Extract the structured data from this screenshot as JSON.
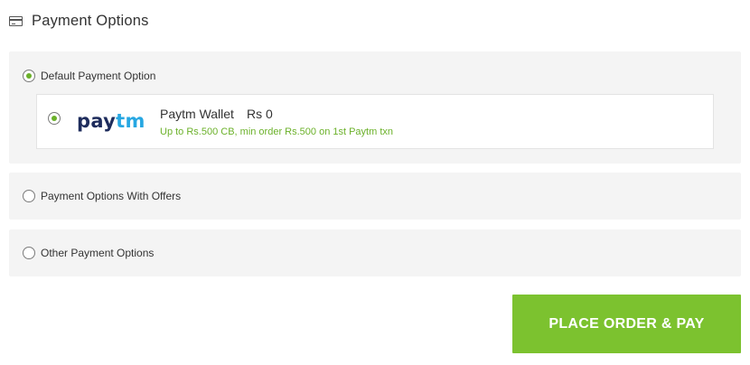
{
  "header": {
    "title": "Payment Options",
    "icon": "credit-card-icon"
  },
  "sections": {
    "default": {
      "label": "Default Payment Option",
      "selected": true
    },
    "offers": {
      "label": "Payment Options With Offers",
      "selected": false
    },
    "other": {
      "label": "Other Payment Options",
      "selected": false
    }
  },
  "wallet": {
    "logo_pay": "pay",
    "logo_tm": "tm",
    "name": "Paytm Wallet",
    "amount": "Rs 0",
    "offer": "Up to Rs.500 CB, min order Rs.500 on 1st Paytm txn",
    "selected": true
  },
  "actions": {
    "place_order_label": "PLACE ORDER & PAY"
  },
  "colors": {
    "accent_green": "#7cc22f",
    "offer_green": "#6bb12a",
    "paytm_navy": "#1e2c5c",
    "paytm_blue": "#27a7e2",
    "section_bg": "#f4f4f4"
  }
}
